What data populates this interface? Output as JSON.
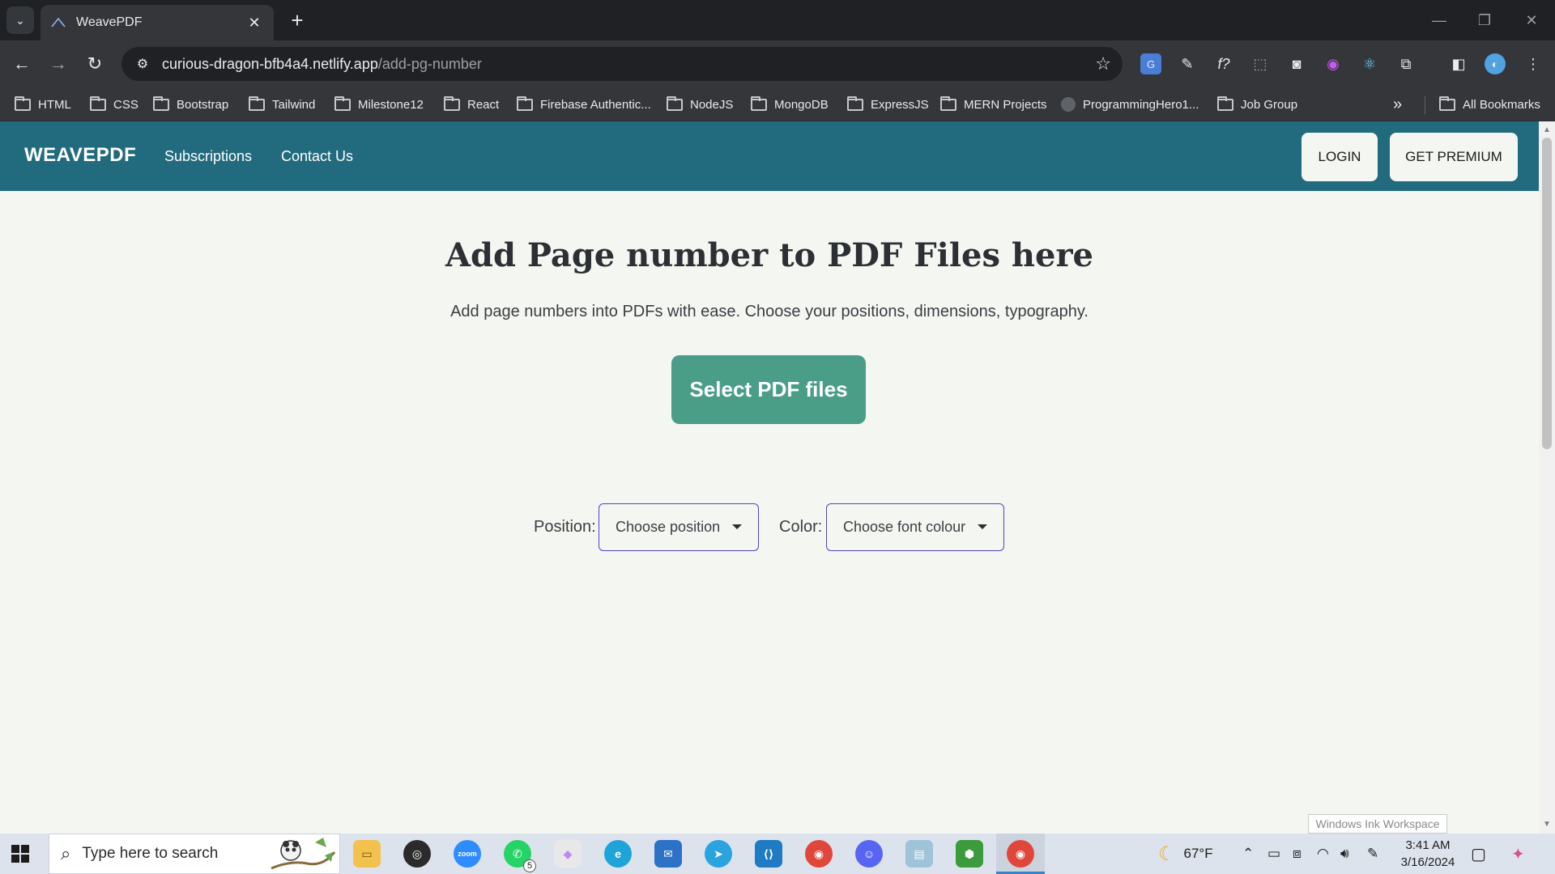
{
  "browser": {
    "tab_title": "WeavePDF",
    "url_host": "curious-dragon-bfb4a4.netlify.app",
    "url_path": "/add-pg-number",
    "bookmarks": [
      {
        "label": "HTML",
        "icon": "folder-icon"
      },
      {
        "label": "CSS",
        "icon": "folder-icon"
      },
      {
        "label": "Bootstrap",
        "icon": "folder-icon"
      },
      {
        "label": "Tailwind",
        "icon": "folder-icon"
      },
      {
        "label": "Milestone12",
        "icon": "folder-icon"
      },
      {
        "label": "React",
        "icon": "folder-icon"
      },
      {
        "label": "Firebase Authentic...",
        "icon": "folder-icon"
      },
      {
        "label": "NodeJS",
        "icon": "folder-icon"
      },
      {
        "label": "MongoDB",
        "icon": "folder-icon"
      },
      {
        "label": "ExpressJS",
        "icon": "folder-icon"
      },
      {
        "label": "MERN Projects",
        "icon": "folder-icon"
      },
      {
        "label": "ProgrammingHero1...",
        "icon": "github-icon"
      },
      {
        "label": "Job Group",
        "icon": "folder-icon"
      }
    ],
    "all_bookmarks": "All Bookmarks",
    "more_bookmarks": "»"
  },
  "site": {
    "brand": "WEAVEPDF",
    "nav": [
      "Subscriptions",
      "Contact Us"
    ],
    "login": "LOGIN",
    "premium": "GET PREMIUM",
    "title": "Add Page number to PDF Files here",
    "subtitle": "Add page numbers into PDFs with ease. Choose your positions, dimensions, typography.",
    "select_button": "Select PDF files",
    "position_label": "Position:",
    "position_placeholder": "Choose position",
    "color_label": "Color:",
    "color_placeholder": "Choose font colour",
    "brand_color": "#226a7d",
    "accent_color": "#4a9e88"
  },
  "overlay": {
    "ink_tooltip": "Windows Ink Workspace"
  },
  "taskbar": {
    "search_placeholder": "Type here to search",
    "whatsapp_badge": "5",
    "weather_temp": "67°F",
    "time": "3:41 AM",
    "date": "3/16/2024"
  }
}
